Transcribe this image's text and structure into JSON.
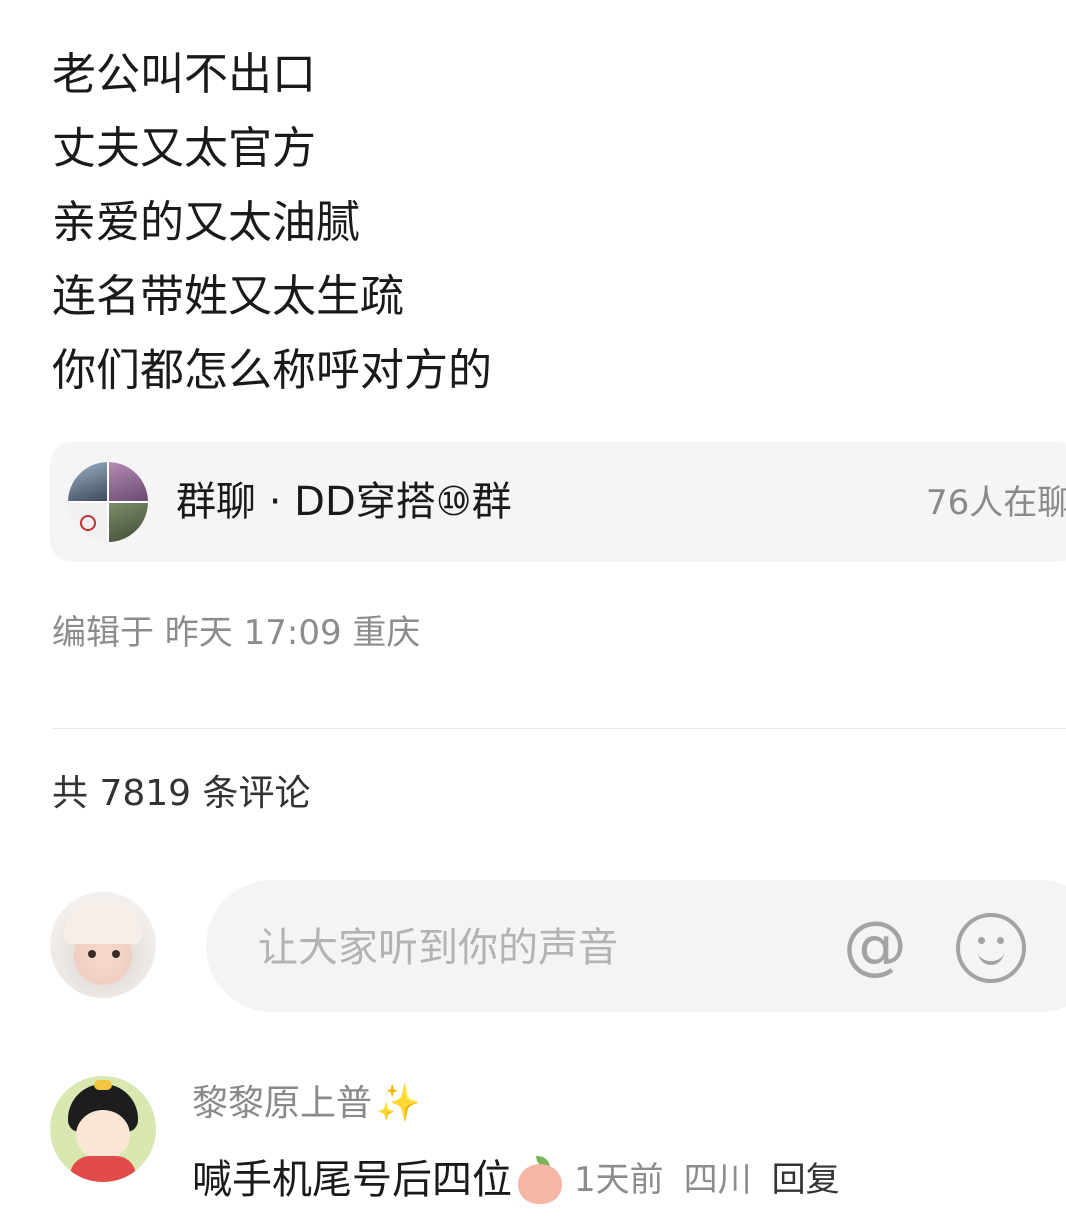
{
  "post": {
    "lines": [
      "老公叫不出口",
      "丈夫又太官方",
      "亲爱的又太油腻",
      "连名带姓又太生疏",
      "你们都怎么称呼对方的"
    ]
  },
  "group_card": {
    "title": "群聊 · DD穿搭⑩群",
    "online": "76人在聊"
  },
  "edit_meta": "编辑于 昨天 17:09 重庆",
  "comments_header": {
    "count_text": "共 7819 条评论"
  },
  "comment_input": {
    "placeholder": "让大家听到你的声音",
    "at_icon": "at-icon",
    "emoji_icon": "smiley-icon",
    "at_label": "@"
  },
  "comments": [
    {
      "username": "黎黎原上普",
      "username_decoration": "✨",
      "text": "喊手机尾号后四位",
      "emoji": "peach-icon",
      "time": "1天前",
      "location": "四川",
      "reply_label": "回复"
    }
  ]
}
